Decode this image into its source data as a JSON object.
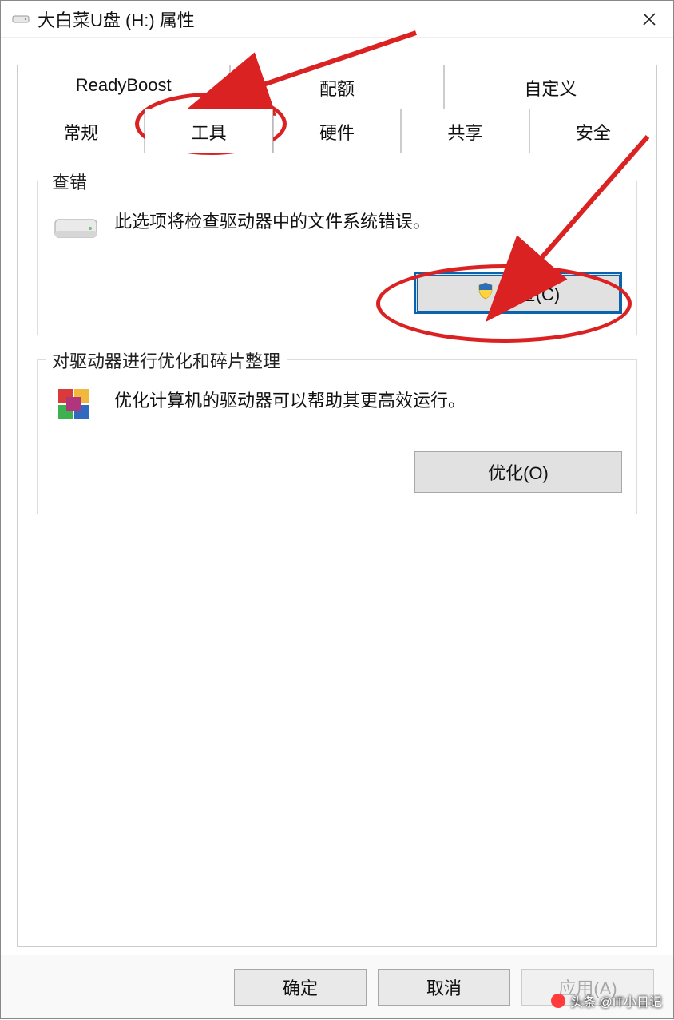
{
  "window": {
    "title": "大白菜U盘 (H:) 属性"
  },
  "tabs": {
    "row1": [
      "ReadyBoost",
      "配额",
      "自定义"
    ],
    "row2": [
      "常规",
      "工具",
      "硬件",
      "共享",
      "安全"
    ],
    "active": "工具"
  },
  "group_check": {
    "legend": "查错",
    "desc": "此选项将检查驱动器中的文件系统错误。",
    "button": "检查(C)"
  },
  "group_opt": {
    "legend": "对驱动器进行优化和碎片整理",
    "desc": "优化计算机的驱动器可以帮助其更高效运行。",
    "button": "优化(O)"
  },
  "footer": {
    "ok": "确定",
    "cancel": "取消",
    "apply": "应用(A)"
  },
  "watermark": "头条 @IT小日记"
}
